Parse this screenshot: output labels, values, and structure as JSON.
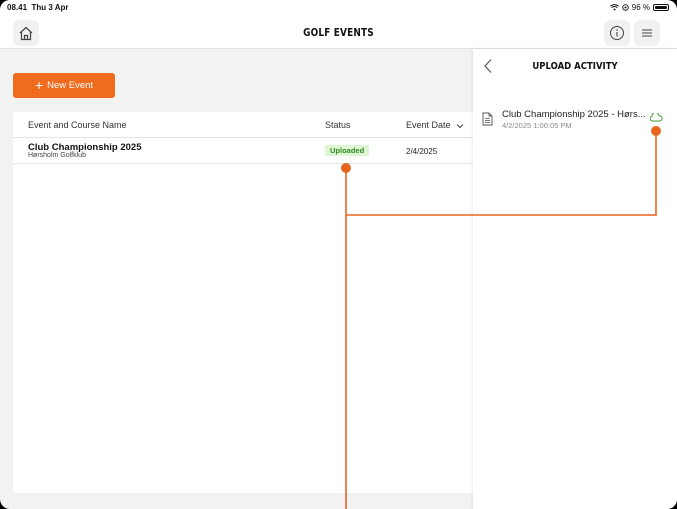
{
  "status_bar": {
    "time": "08.41",
    "date": "Thu 3 Apr",
    "battery": "96 %"
  },
  "nav": {
    "title": "GOLF EVENTS"
  },
  "main": {
    "new_event_label": "New Event",
    "table": {
      "headers": {
        "name": "Event and Course Name",
        "status": "Status",
        "date": "Event Date"
      },
      "rows": [
        {
          "event": "Club Championship 2025",
          "course": "Hørsholm Golfklub",
          "status": "Uploaded",
          "date": "2/4/2025"
        }
      ]
    }
  },
  "panel": {
    "title": "UPLOAD ACTIVITY",
    "items": [
      {
        "title": "Club Championship 2025 - Hørs...",
        "time": "4/2/2025 1:00:05 PM"
      }
    ]
  },
  "colors": {
    "accent": "#ef6b1e",
    "uploaded_bg": "#dff5d4",
    "uploaded_text": "#2e8b1f",
    "annotation": "#e8651e"
  }
}
